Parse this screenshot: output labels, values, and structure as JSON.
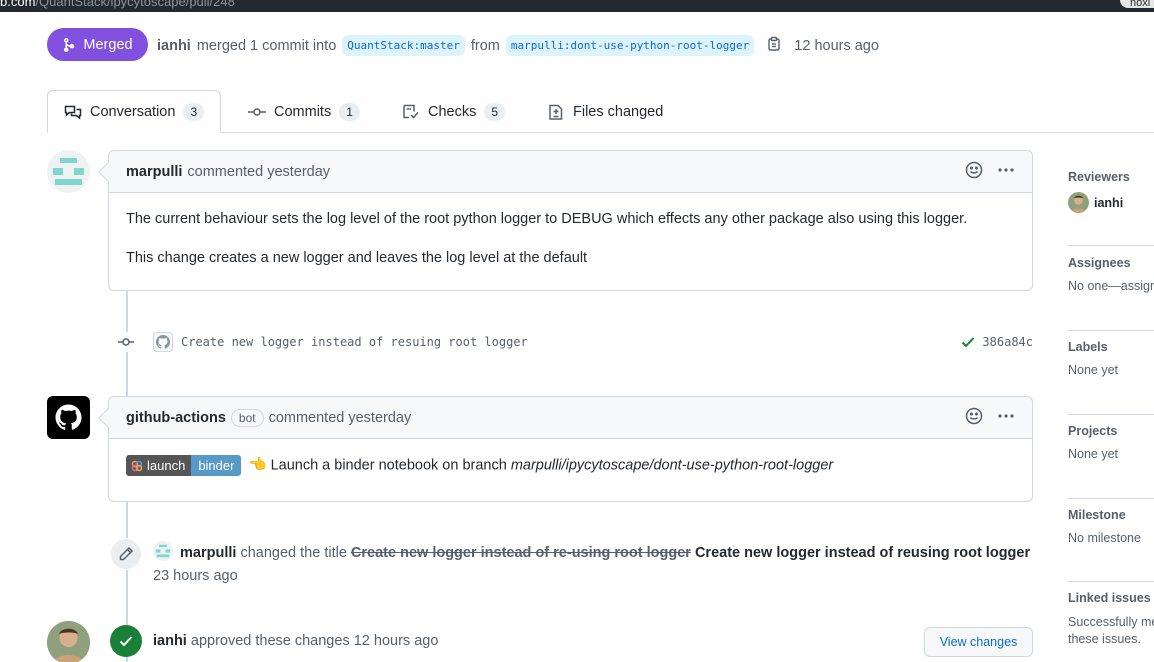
{
  "browser": {
    "url_prefix": "b.com",
    "url_path": "/QuantStack/ipycytoscape/pull/248"
  },
  "pr_header": {
    "state": "Merged",
    "user": "ianhi",
    "action": "merged 1 commit into",
    "base_branch": "QuantStack:master",
    "from_word": "from",
    "head_branch": "marpulli:dont-use-python-root-logger",
    "time": "12 hours ago"
  },
  "tabs": [
    {
      "label": "Conversation",
      "count": "3"
    },
    {
      "label": "Commits",
      "count": "1"
    },
    {
      "label": "Checks",
      "count": "5"
    },
    {
      "label": "Files changed",
      "count": ""
    }
  ],
  "comment1": {
    "author": "marpulli",
    "meta": "commented yesterday",
    "body": [
      "The current behaviour sets the log level of the root python logger to DEBUG which effects any other package also using this logger.",
      "This change creates a new logger and leaves the log level at the default"
    ]
  },
  "commit": {
    "message": "Create new logger instead of resuing root logger",
    "sha": "386a84c"
  },
  "comment2": {
    "author": "github-actions",
    "badge": "bot",
    "meta": "commented yesterday",
    "binder_left": "launch",
    "binder_right": "binder",
    "emoji": "👈",
    "text": "Launch a binder notebook on branch",
    "branch": "marpulli/ipycytoscape/dont-use-python-root-logger"
  },
  "rename_event": {
    "user": "marpulli",
    "action": "changed the title",
    "old_title": "Create new logger instead of re-using root logger",
    "new_title": "Create new logger instead of reusing root logger",
    "time": "23 hours ago"
  },
  "approve_event": {
    "user": "ianhi",
    "action": "approved these changes",
    "time": "12 hours ago",
    "button": "View changes"
  },
  "sidebar": {
    "reviewers": {
      "heading": "Reviewers",
      "value": "ianhi"
    },
    "assignees": {
      "heading": "Assignees",
      "value": "No one—assign yourself"
    },
    "labels": {
      "heading": "Labels",
      "value": "None yet"
    },
    "projects": {
      "heading": "Projects",
      "value": "None yet"
    },
    "milestone": {
      "heading": "Milestone",
      "value": "No milestone"
    },
    "linked": {
      "heading": "Linked issues",
      "value1": "Successfully merging this pull request may close",
      "value2": "these issues."
    }
  },
  "colors": {
    "merged": "#8250df",
    "link": "#0969da",
    "success": "#1a7f37",
    "border": "#d0d7de"
  }
}
